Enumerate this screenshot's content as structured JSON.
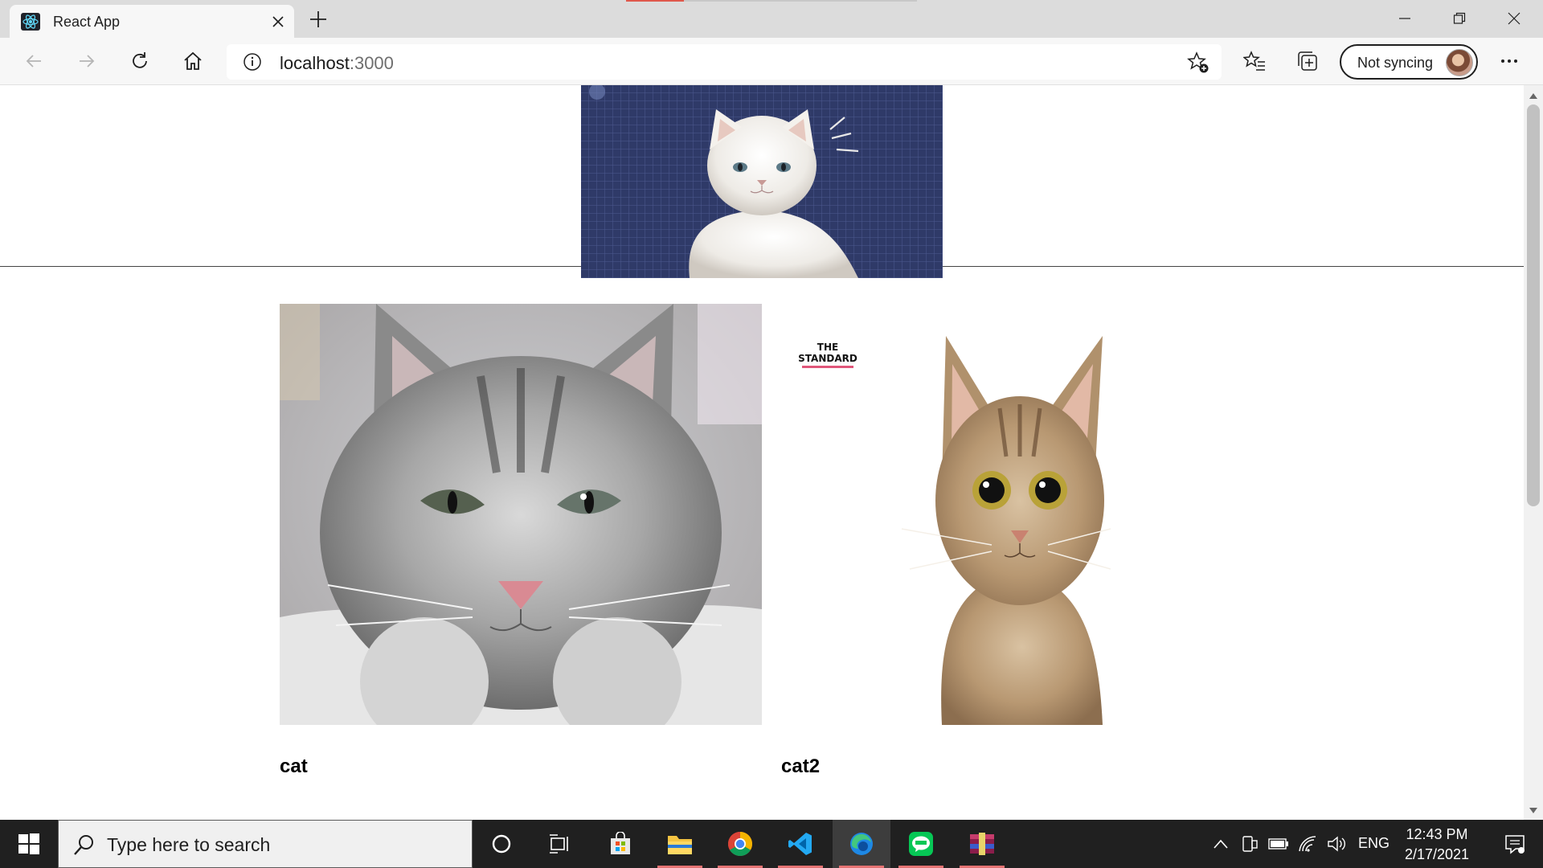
{
  "browser": {
    "tab_title": "React App",
    "url_host": "localhost",
    "url_port": ":3000",
    "sync_label": "Not syncing"
  },
  "page": {
    "banner_icon": "white-persian-cat-image",
    "cards": [
      {
        "name": "cat",
        "image": "grey-kitten-photo"
      },
      {
        "name": "cat2",
        "image": "tabby-cat-photo",
        "watermark_lines": [
          "THE",
          "STANDARD"
        ]
      }
    ]
  },
  "taskbar": {
    "search_placeholder": "Type here to search",
    "language": "ENG",
    "time": "12:43 PM",
    "date": "2/17/2021",
    "pinned_apps": [
      "cortana",
      "task-view",
      "microsoft-store",
      "file-explorer",
      "chrome",
      "vscode",
      "edge",
      "line",
      "winrar"
    ]
  },
  "colors": {
    "accent_running": "#e57373",
    "banner_bg": "#2f3a68"
  }
}
